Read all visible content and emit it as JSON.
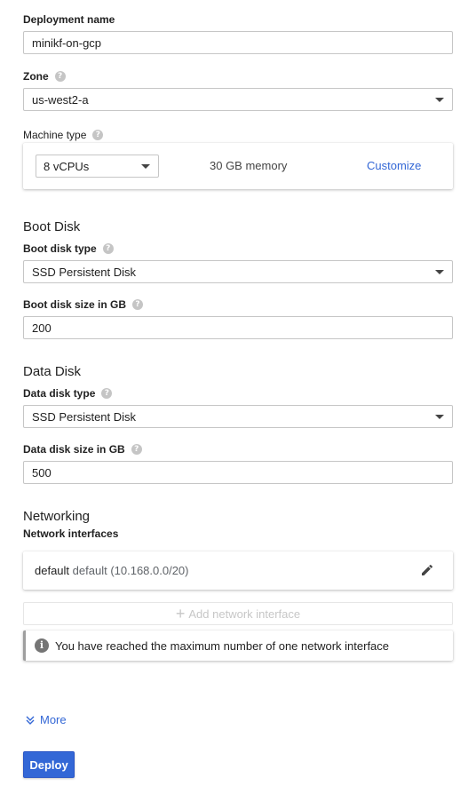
{
  "deployment": {
    "label": "Deployment name",
    "value": "minikf-on-gcp"
  },
  "zone": {
    "label": "Zone",
    "value": "us-west2-a"
  },
  "machine": {
    "label": "Machine type",
    "cpus": "8 vCPUs",
    "memory": "30 GB memory",
    "customize": "Customize"
  },
  "boot_disk": {
    "title": "Boot Disk",
    "type_label": "Boot disk type",
    "type_value": "SSD Persistent Disk",
    "size_label": "Boot disk size in GB",
    "size_value": "200"
  },
  "data_disk": {
    "title": "Data Disk",
    "type_label": "Data disk type",
    "type_value": "SSD Persistent Disk",
    "size_label": "Data disk size in GB",
    "size_value": "500"
  },
  "networking": {
    "title": "Networking",
    "interfaces_label": "Network interfaces",
    "interface_name": "default",
    "interface_detail": "default (10.168.0.0/20)",
    "add_label": "Add network interface",
    "info_message": "You have reached the maximum number of one network interface"
  },
  "more_label": "More",
  "deploy_label": "Deploy",
  "colors": {
    "accent": "#3367d6",
    "border": "#c6c6c6",
    "help": "#c5c5c5"
  }
}
